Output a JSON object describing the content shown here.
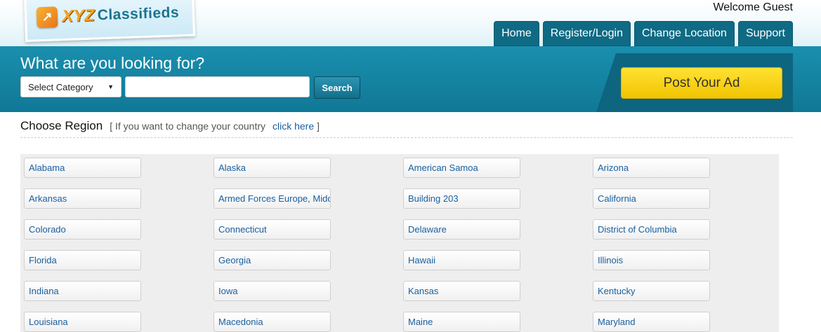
{
  "logo": {
    "mark": "↗",
    "brand_xyz": "XYZ",
    "brand_rest": "Classifieds"
  },
  "header": {
    "welcome": "Welcome Guest"
  },
  "nav": {
    "items": [
      "Home",
      "Register/Login",
      "Change Location",
      "Support"
    ]
  },
  "search": {
    "title": "What are you looking for?",
    "category_selected": "Select Category",
    "input_value": "",
    "button_label": "Search"
  },
  "post_ad": {
    "label": "Post Your Ad"
  },
  "region": {
    "title": "Choose Region",
    "note": "[ If you want to change your country",
    "link": "click here",
    "note_close": "]",
    "items": [
      "Alabama",
      "Alaska",
      "American Samoa",
      "Arizona",
      "Arkansas",
      "Armed Forces Europe, Middle East, Africa & Canada",
      "Building 203",
      "California",
      "Colorado",
      "Connecticut",
      "Delaware",
      "District of Columbia",
      "Florida",
      "Georgia",
      "Hawaii",
      "Illinois",
      "Indiana",
      "Iowa",
      "Kansas",
      "Kentucky",
      "Louisiana",
      "Macedonia",
      "Maine",
      "Maryland"
    ]
  },
  "colors": {
    "nav_bg": "#0f6a84",
    "band_bg": "#107896",
    "post_btn": "#ffd700",
    "link": "#1a5fa0"
  }
}
